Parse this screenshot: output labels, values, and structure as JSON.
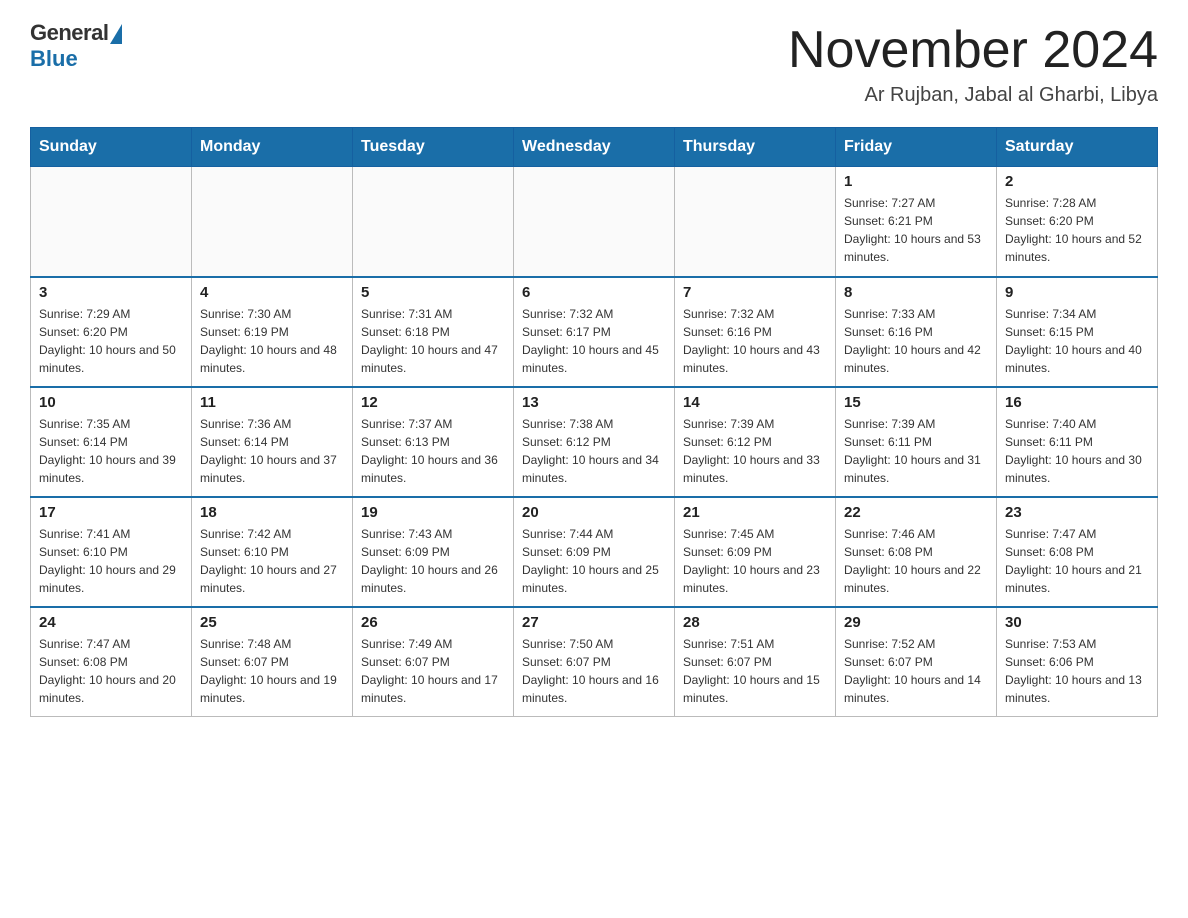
{
  "header": {
    "logo": {
      "general": "General",
      "blue": "Blue"
    },
    "title": "November 2024",
    "location": "Ar Rujban, Jabal al Gharbi, Libya"
  },
  "calendar": {
    "days_of_week": [
      "Sunday",
      "Monday",
      "Tuesday",
      "Wednesday",
      "Thursday",
      "Friday",
      "Saturday"
    ],
    "weeks": [
      [
        {
          "day": "",
          "sunrise": "",
          "sunset": "",
          "daylight": ""
        },
        {
          "day": "",
          "sunrise": "",
          "sunset": "",
          "daylight": ""
        },
        {
          "day": "",
          "sunrise": "",
          "sunset": "",
          "daylight": ""
        },
        {
          "day": "",
          "sunrise": "",
          "sunset": "",
          "daylight": ""
        },
        {
          "day": "",
          "sunrise": "",
          "sunset": "",
          "daylight": ""
        },
        {
          "day": "1",
          "sunrise": "Sunrise: 7:27 AM",
          "sunset": "Sunset: 6:21 PM",
          "daylight": "Daylight: 10 hours and 53 minutes."
        },
        {
          "day": "2",
          "sunrise": "Sunrise: 7:28 AM",
          "sunset": "Sunset: 6:20 PM",
          "daylight": "Daylight: 10 hours and 52 minutes."
        }
      ],
      [
        {
          "day": "3",
          "sunrise": "Sunrise: 7:29 AM",
          "sunset": "Sunset: 6:20 PM",
          "daylight": "Daylight: 10 hours and 50 minutes."
        },
        {
          "day": "4",
          "sunrise": "Sunrise: 7:30 AM",
          "sunset": "Sunset: 6:19 PM",
          "daylight": "Daylight: 10 hours and 48 minutes."
        },
        {
          "day": "5",
          "sunrise": "Sunrise: 7:31 AM",
          "sunset": "Sunset: 6:18 PM",
          "daylight": "Daylight: 10 hours and 47 minutes."
        },
        {
          "day": "6",
          "sunrise": "Sunrise: 7:32 AM",
          "sunset": "Sunset: 6:17 PM",
          "daylight": "Daylight: 10 hours and 45 minutes."
        },
        {
          "day": "7",
          "sunrise": "Sunrise: 7:32 AM",
          "sunset": "Sunset: 6:16 PM",
          "daylight": "Daylight: 10 hours and 43 minutes."
        },
        {
          "day": "8",
          "sunrise": "Sunrise: 7:33 AM",
          "sunset": "Sunset: 6:16 PM",
          "daylight": "Daylight: 10 hours and 42 minutes."
        },
        {
          "day": "9",
          "sunrise": "Sunrise: 7:34 AM",
          "sunset": "Sunset: 6:15 PM",
          "daylight": "Daylight: 10 hours and 40 minutes."
        }
      ],
      [
        {
          "day": "10",
          "sunrise": "Sunrise: 7:35 AM",
          "sunset": "Sunset: 6:14 PM",
          "daylight": "Daylight: 10 hours and 39 minutes."
        },
        {
          "day": "11",
          "sunrise": "Sunrise: 7:36 AM",
          "sunset": "Sunset: 6:14 PM",
          "daylight": "Daylight: 10 hours and 37 minutes."
        },
        {
          "day": "12",
          "sunrise": "Sunrise: 7:37 AM",
          "sunset": "Sunset: 6:13 PM",
          "daylight": "Daylight: 10 hours and 36 minutes."
        },
        {
          "day": "13",
          "sunrise": "Sunrise: 7:38 AM",
          "sunset": "Sunset: 6:12 PM",
          "daylight": "Daylight: 10 hours and 34 minutes."
        },
        {
          "day": "14",
          "sunrise": "Sunrise: 7:39 AM",
          "sunset": "Sunset: 6:12 PM",
          "daylight": "Daylight: 10 hours and 33 minutes."
        },
        {
          "day": "15",
          "sunrise": "Sunrise: 7:39 AM",
          "sunset": "Sunset: 6:11 PM",
          "daylight": "Daylight: 10 hours and 31 minutes."
        },
        {
          "day": "16",
          "sunrise": "Sunrise: 7:40 AM",
          "sunset": "Sunset: 6:11 PM",
          "daylight": "Daylight: 10 hours and 30 minutes."
        }
      ],
      [
        {
          "day": "17",
          "sunrise": "Sunrise: 7:41 AM",
          "sunset": "Sunset: 6:10 PM",
          "daylight": "Daylight: 10 hours and 29 minutes."
        },
        {
          "day": "18",
          "sunrise": "Sunrise: 7:42 AM",
          "sunset": "Sunset: 6:10 PM",
          "daylight": "Daylight: 10 hours and 27 minutes."
        },
        {
          "day": "19",
          "sunrise": "Sunrise: 7:43 AM",
          "sunset": "Sunset: 6:09 PM",
          "daylight": "Daylight: 10 hours and 26 minutes."
        },
        {
          "day": "20",
          "sunrise": "Sunrise: 7:44 AM",
          "sunset": "Sunset: 6:09 PM",
          "daylight": "Daylight: 10 hours and 25 minutes."
        },
        {
          "day": "21",
          "sunrise": "Sunrise: 7:45 AM",
          "sunset": "Sunset: 6:09 PM",
          "daylight": "Daylight: 10 hours and 23 minutes."
        },
        {
          "day": "22",
          "sunrise": "Sunrise: 7:46 AM",
          "sunset": "Sunset: 6:08 PM",
          "daylight": "Daylight: 10 hours and 22 minutes."
        },
        {
          "day": "23",
          "sunrise": "Sunrise: 7:47 AM",
          "sunset": "Sunset: 6:08 PM",
          "daylight": "Daylight: 10 hours and 21 minutes."
        }
      ],
      [
        {
          "day": "24",
          "sunrise": "Sunrise: 7:47 AM",
          "sunset": "Sunset: 6:08 PM",
          "daylight": "Daylight: 10 hours and 20 minutes."
        },
        {
          "day": "25",
          "sunrise": "Sunrise: 7:48 AM",
          "sunset": "Sunset: 6:07 PM",
          "daylight": "Daylight: 10 hours and 19 minutes."
        },
        {
          "day": "26",
          "sunrise": "Sunrise: 7:49 AM",
          "sunset": "Sunset: 6:07 PM",
          "daylight": "Daylight: 10 hours and 17 minutes."
        },
        {
          "day": "27",
          "sunrise": "Sunrise: 7:50 AM",
          "sunset": "Sunset: 6:07 PM",
          "daylight": "Daylight: 10 hours and 16 minutes."
        },
        {
          "day": "28",
          "sunrise": "Sunrise: 7:51 AM",
          "sunset": "Sunset: 6:07 PM",
          "daylight": "Daylight: 10 hours and 15 minutes."
        },
        {
          "day": "29",
          "sunrise": "Sunrise: 7:52 AM",
          "sunset": "Sunset: 6:07 PM",
          "daylight": "Daylight: 10 hours and 14 minutes."
        },
        {
          "day": "30",
          "sunrise": "Sunrise: 7:53 AM",
          "sunset": "Sunset: 6:06 PM",
          "daylight": "Daylight: 10 hours and 13 minutes."
        }
      ]
    ]
  }
}
